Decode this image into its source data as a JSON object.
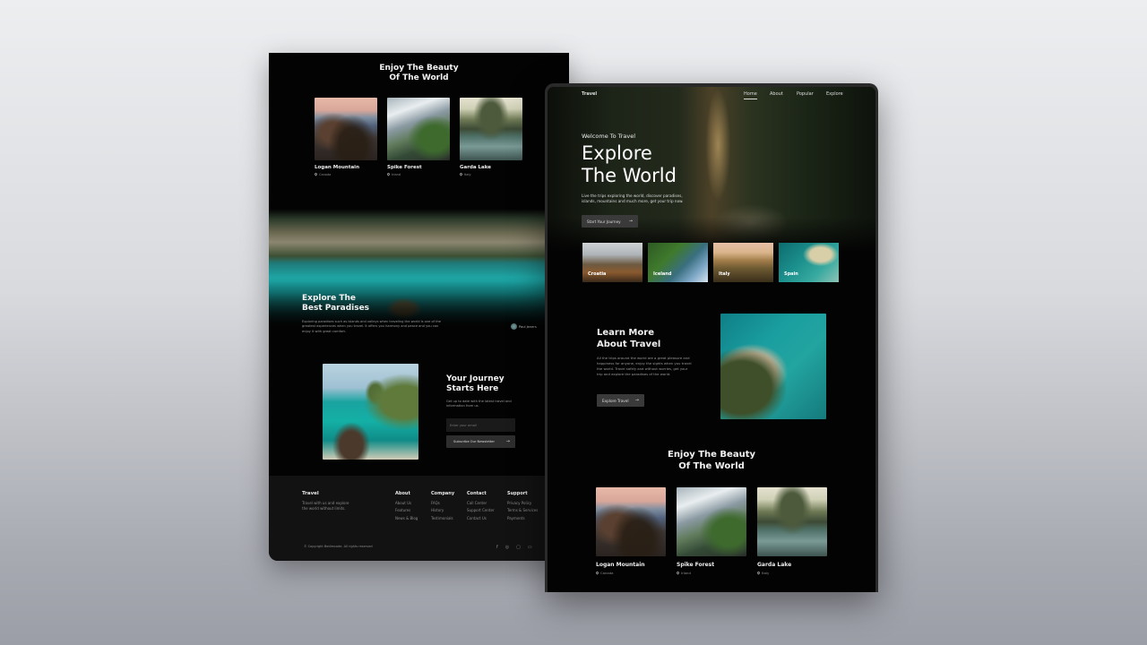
{
  "left_page": {
    "beauty_section": {
      "title_line1": "Enjoy The Beauty",
      "title_line2": "Of The World",
      "cards": [
        {
          "name": "Logan Mountain",
          "location": "Canada"
        },
        {
          "name": "Spike Forest",
          "location": "Irland"
        },
        {
          "name": "Garda Lake",
          "location": "Italy"
        }
      ]
    },
    "paradise_section": {
      "title_line1": "Explore The",
      "title_line2": "Best Paradises",
      "description": "Exploring paradises such as islands and valleys when traveling the world is one of the greatest experiences when you travel. It offers you harmony and peace and you can enjoy it with great comfort.",
      "author": "Paul Jeners"
    },
    "newsletter_section": {
      "title_line1": "Your Journey",
      "title_line2": "Starts Here",
      "description": "Get up to date with the latest travel and information from us.",
      "email_placeholder": "Enter your email",
      "subscribe_label": "Subscribe Our Newsletter"
    },
    "footer": {
      "brand": "Travel",
      "tagline_line1": "Travel with us and explore",
      "tagline_line2": "the world without limits.",
      "columns": [
        {
          "title": "About",
          "links": [
            "About Us",
            "Features",
            "News & Blog"
          ]
        },
        {
          "title": "Company",
          "links": [
            "FAQs",
            "History",
            "Testimonials"
          ]
        },
        {
          "title": "Contact",
          "links": [
            "Call Center",
            "Support Center",
            "Contact Us"
          ]
        },
        {
          "title": "Support",
          "links": [
            "Privacy Policy",
            "Terms & Services",
            "Payments"
          ]
        }
      ],
      "copyright": "© Copyright Bedimcode. All rights reserved",
      "social_icons": [
        "facebook-icon",
        "instagram-icon",
        "twitter-icon",
        "message-icon"
      ]
    }
  },
  "right_page": {
    "nav": {
      "brand": "Travel",
      "items": [
        {
          "label": "Home",
          "active": true
        },
        {
          "label": "About",
          "active": false
        },
        {
          "label": "Popular",
          "active": false
        },
        {
          "label": "Explore",
          "active": false
        }
      ]
    },
    "hero": {
      "subtitle": "Welcome To Travel",
      "title_line1": "Explore",
      "title_line2": "The World",
      "description_line1": "Live the trips exploring the world, discover paradises,",
      "description_line2": "islands, mountains and much more, get your trip now.",
      "cta_label": "Start Your Journey"
    },
    "destinations": [
      "Croatia",
      "Iceland",
      "Italy",
      "Spain"
    ],
    "about_section": {
      "title_line1": "Learn More",
      "title_line2": "About Travel",
      "description": "All the trips around the world are a great pleasure and happiness for anyone, enjoy the sights when you travel the world. Travel safely and without worries, get your trip and explore the paradises of the world.",
      "cta_label": "Explore Travel"
    },
    "beauty_section": {
      "title_line1": "Enjoy The Beauty",
      "title_line2": "Of The World",
      "cards": [
        {
          "name": "Logan Mountain",
          "location": "Canada"
        },
        {
          "name": "Spike Forest",
          "location": "Irland"
        },
        {
          "name": "Garda Lake",
          "location": "Italy"
        }
      ]
    }
  }
}
